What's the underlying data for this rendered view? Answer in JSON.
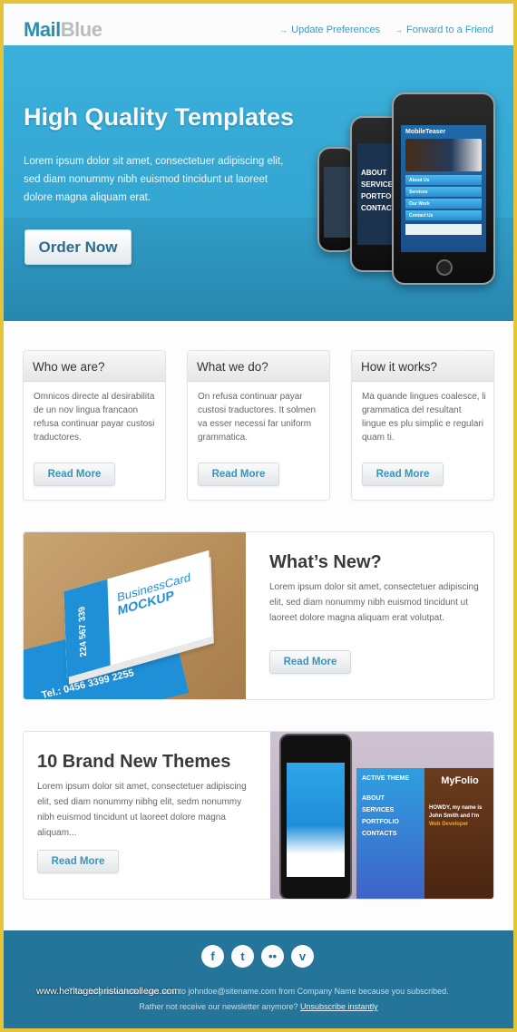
{
  "header": {
    "logo_part1": "Mail",
    "logo_part2": "Blue",
    "links": [
      {
        "icon": "arrow-right-icon",
        "glyph": "→",
        "label": "Update Preferences"
      },
      {
        "icon": "arrow-right-icon",
        "glyph": "→",
        "label": "Forward to a Friend"
      }
    ]
  },
  "hero": {
    "title": "High Quality Templates",
    "text": "Lorem ipsum dolor sit amet, consectetuer adipiscing elit, sed diam nonummy nibh euismod tincidunt ut laoreet dolore magna aliquam erat.",
    "button_label": "Order Now",
    "phone_back_menu": [
      "ABOUT",
      "SERVICES",
      "PORTFOLIO",
      "CONTACT"
    ],
    "phone_front_title": "MobileTeaser",
    "phone_front_menu": [
      "About Us",
      "Services",
      "Our Work",
      "Contact Us"
    ]
  },
  "cards": [
    {
      "title": "Who we are?",
      "text": "Omnicos directe al desirabilita de un nov lingua francaon refusa continuar payar custosi traductores.",
      "button_label": "Read More"
    },
    {
      "title": "What we do?",
      "text": "On refusa continuar payar custosi traductores. It solmen va esser necessi far uniform grammatica.",
      "button_label": "Read More"
    },
    {
      "title": "How it works?",
      "text": "Ma quande lingues coalesce, li grammatica del resultant lingue es plu simplic e regulari quam ti.",
      "button_label": "Read More"
    }
  ],
  "whats_new": {
    "title": "What’s New?",
    "text": "Lorem ipsum dolor sit amet, consectetuer adipiscing elit, sed diam nonummy nibh euismod tincidunt ut laoreet dolore magna aliquam erat volutpat.",
    "button_label": "Read More",
    "image": {
      "line1": "BusinessCard",
      "line2": "MOCKUP",
      "phone": "224 567 339",
      "tel": "Tel.: 0456 3399 2255"
    }
  },
  "themes": {
    "title": "10 Brand New Themes",
    "text": "Lorem ipsum dolor sit amet, consectetuer adipiscing elit, sed diam nonummy nibhg elit, sedm nonummy nibh euismod tincidunt ut laoreet dolore magna aliquam...",
    "button_label": "Read More",
    "image": {
      "active_title": "ACTIVE THEME",
      "active_menu": [
        "ABOUT",
        "SERVICES",
        "PORTFOLIO",
        "CONTACTS"
      ],
      "folio_title": "MyFolio",
      "folio_howdy": "HOWDY, my name is John Smith and I'm",
      "folio_role": "Web Developer"
    }
  },
  "footer": {
    "socials": [
      {
        "name": "facebook-icon",
        "glyph": "f"
      },
      {
        "name": "twitter-icon",
        "glyph": "t"
      },
      {
        "name": "flickr-icon",
        "glyph": "••"
      },
      {
        "name": "vimeo-icon",
        "glyph": "v"
      }
    ],
    "line1": "This daily newsletter was sent to johndoe@sitename.com from Company Name because you subscribed.",
    "line2_prefix": "Rather not receive our newsletter anymore?",
    "unsubscribe_label": "Unsubscribe instantly",
    "watermark": "www.heritagechristiancollege.com"
  },
  "colors": {
    "brand_blue": "#2a8fb0",
    "hero_blue": "#33a6d2",
    "footer_blue": "#25749a",
    "link_blue": "#3994bd",
    "frame_yellow": "#e3c43a"
  }
}
